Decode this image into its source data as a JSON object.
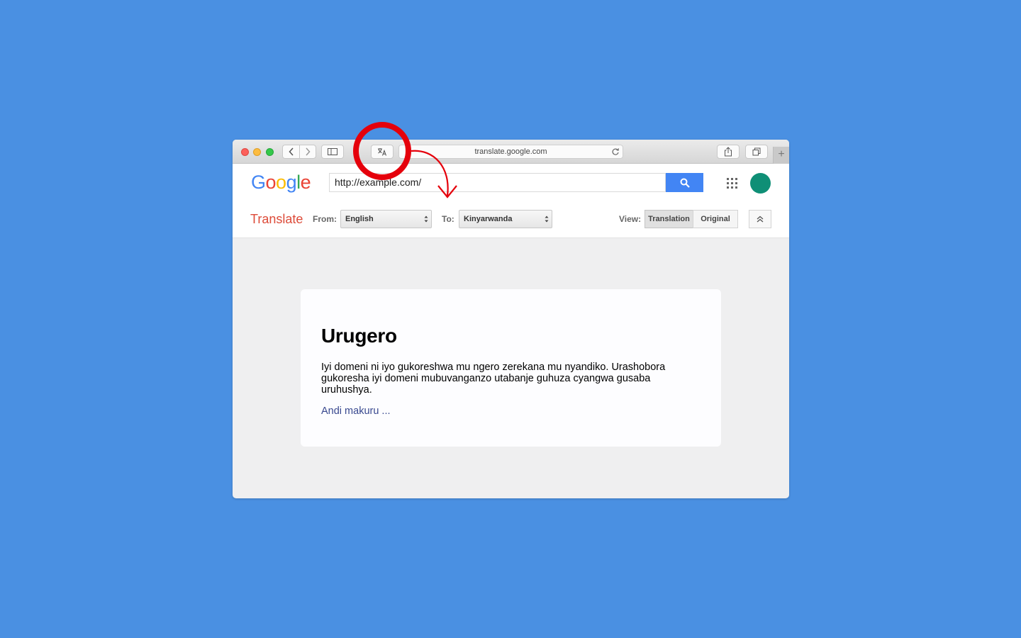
{
  "browser": {
    "address": "translate.google.com",
    "new_tab_label": "+"
  },
  "google_bar": {
    "logo_letters": [
      {
        "char": "G",
        "color": "#4285f4"
      },
      {
        "char": "o",
        "color": "#ea4335"
      },
      {
        "char": "o",
        "color": "#fbbc05"
      },
      {
        "char": "g",
        "color": "#4285f4"
      },
      {
        "char": "l",
        "color": "#34a853"
      },
      {
        "char": "e",
        "color": "#ea4335"
      }
    ],
    "search_value": "http://example.com/",
    "avatar_color": "#0f8f76"
  },
  "translate_bar": {
    "title": "Translate",
    "from_label": "From:",
    "from_value": "English",
    "to_label": "To:",
    "to_value": "Kinyarwanda",
    "view_label": "View:",
    "view_translation": "Translation",
    "view_original": "Original"
  },
  "content": {
    "heading": "Urugero",
    "body": "Iyi domeni ni iyo gukoreshwa mu ngero zerekana mu nyandiko. Urashobora gukoresha iyi domeni mubuvanganzo utabanje guhuza cyangwa gusaba uruhushya.",
    "link": "Andi makuru ..."
  },
  "annotation": {
    "highlight_color": "#e5000b",
    "target": "translate-icon"
  }
}
